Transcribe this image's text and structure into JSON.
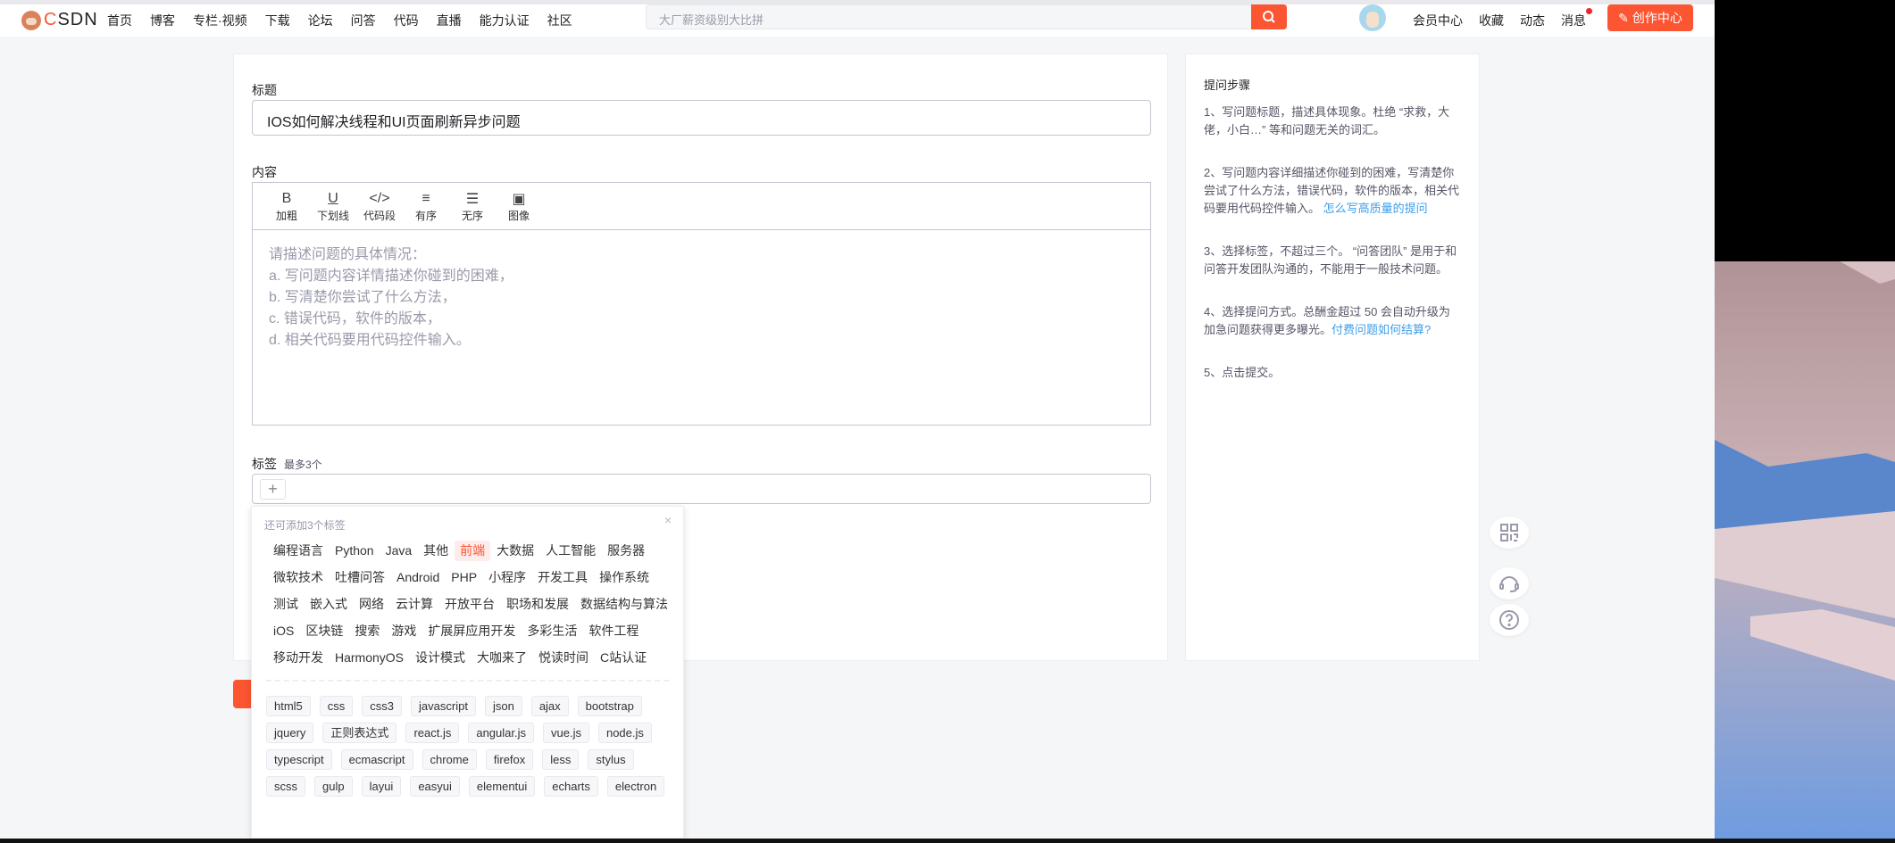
{
  "header": {
    "logo_text": "CSDN",
    "nav": [
      "首页",
      "博客",
      "专栏·视频",
      "下载",
      "论坛",
      "问答",
      "代码",
      "直播",
      "能力认证",
      "社区"
    ],
    "search_placeholder": "大厂薪资级别大比拼",
    "right_nav": [
      "会员中心",
      "收藏",
      "动态"
    ],
    "messages": "消息",
    "create_button": "创作中心",
    "accent": "#fc5531"
  },
  "form": {
    "title_label": "标题",
    "title_value": "IOS如何解决线程和UI页面刷新异步问题",
    "content_label": "内容",
    "toolbar": [
      {
        "icon": "bold-icon",
        "glyph": "B",
        "label": "加粗"
      },
      {
        "icon": "underline-icon",
        "glyph": "U",
        "label": "下划线"
      },
      {
        "icon": "code-icon",
        "glyph": "</>",
        "label": "代码段"
      },
      {
        "icon": "ordered-list-icon",
        "glyph": "≡",
        "label": "有序"
      },
      {
        "icon": "unordered-list-icon",
        "glyph": "☰",
        "label": "无序"
      },
      {
        "icon": "image-icon",
        "glyph": "▣",
        "label": "图像"
      }
    ],
    "content_placeholder": [
      "请描述问题的具体情况：",
      "a. 写问题内容详情描述你碰到的困难，",
      "b. 写清楚你尝试了什么方法，",
      "c. 错误代码，软件的版本，",
      "d. 相关代码要用代码控件输入。"
    ],
    "tags_label": "标签",
    "tags_hint": "最多3个"
  },
  "tag_popup": {
    "hint": "还可添加3个标签",
    "categories": [
      "编程语言",
      "Python",
      "Java",
      "其他",
      "前端",
      "大数据",
      "人工智能",
      "服务器",
      "微软技术",
      "吐槽问答",
      "Android",
      "PHP",
      "小程序",
      "开发工具",
      "操作系统",
      "测试",
      "嵌入式",
      "网络",
      "云计算",
      "开放平台",
      "职场和发展",
      "数据结构与算法",
      "iOS",
      "区块链",
      "搜索",
      "游戏",
      "扩展屏应用开发",
      "多彩生活",
      "软件工程",
      "移动开发",
      "HarmonyOS",
      "设计模式",
      "大咖来了",
      "悦读时间",
      "C站认证"
    ],
    "selected_category": "前端",
    "tags": [
      "html5",
      "css",
      "css3",
      "javascript",
      "json",
      "ajax",
      "bootstrap",
      "jquery",
      "正则表达式",
      "react.js",
      "angular.js",
      "vue.js",
      "node.js",
      "typescript",
      "ecmascript",
      "chrome",
      "firefox",
      "less",
      "stylus",
      "scss",
      "gulp",
      "layui",
      "easyui",
      "elementui",
      "echarts",
      "electron"
    ]
  },
  "side": {
    "title": "提问步骤",
    "step1": "1、写问题标题，描述具体现象。杜绝 “求救，大佬，小白…” 等和问题无关的词汇。",
    "step2": "2、写问题内容详细描述你碰到的困难，写清楚你尝试了什么方法，错误代码，软件的版本，相关代码要用代码控件输入。 ",
    "step2_link": "怎么写高质量的提问",
    "step3": "3、选择标签，不超过三个。 “问答团队” 是用于和问答开发团队沟通的，不能用于一般技术问题。",
    "step4": "4、选择提问方式。总酬金超过 50 会自动升级为加急问题获得更多曝光。",
    "step4_link": "付费问题如何结算?",
    "step5": "5、点击提交。",
    "link_color": "#3e9ee8"
  },
  "float_buttons": [
    "qr-code-icon",
    "headset-icon",
    "help-icon"
  ]
}
